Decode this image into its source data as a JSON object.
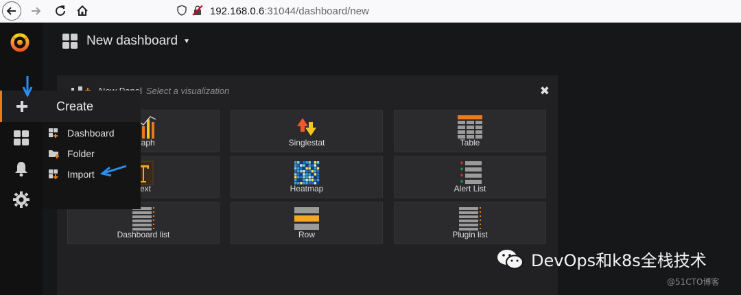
{
  "browser": {
    "url_host": "192.168.0.6",
    "url_path": ":31044/dashboard/new"
  },
  "topbar": {
    "title": "New dashboard"
  },
  "create_menu": {
    "header": "Create",
    "items": [
      {
        "label": "Dashboard",
        "icon": "dashboard-plus-icon"
      },
      {
        "label": "Folder",
        "icon": "folder-plus-icon"
      },
      {
        "label": "Import",
        "icon": "import-icon"
      }
    ]
  },
  "panel": {
    "title": "New Panel",
    "subtitle": "Select a visualization",
    "visualizations": [
      {
        "label": "Graph",
        "icon": "graph-viz-icon"
      },
      {
        "label": "Singlestat",
        "icon": "singlestat-viz-icon"
      },
      {
        "label": "Table",
        "icon": "table-viz-icon"
      },
      {
        "label": "Text",
        "icon": "text-viz-icon"
      },
      {
        "label": "Heatmap",
        "icon": "heatmap-viz-icon"
      },
      {
        "label": "Alert List",
        "icon": "alert-list-viz-icon"
      },
      {
        "label": "Dashboard list",
        "icon": "dashboard-list-viz-icon"
      },
      {
        "label": "Row",
        "icon": "row-viz-icon"
      },
      {
        "label": "Plugin list",
        "icon": "plugin-list-viz-icon"
      }
    ]
  },
  "watermark": {
    "main": "DevOps和k8s全栈技术",
    "small": "@51CTO博客"
  },
  "colors": {
    "accent_orange": "#eb7b18",
    "arrow_blue": "#2a8ff0"
  }
}
